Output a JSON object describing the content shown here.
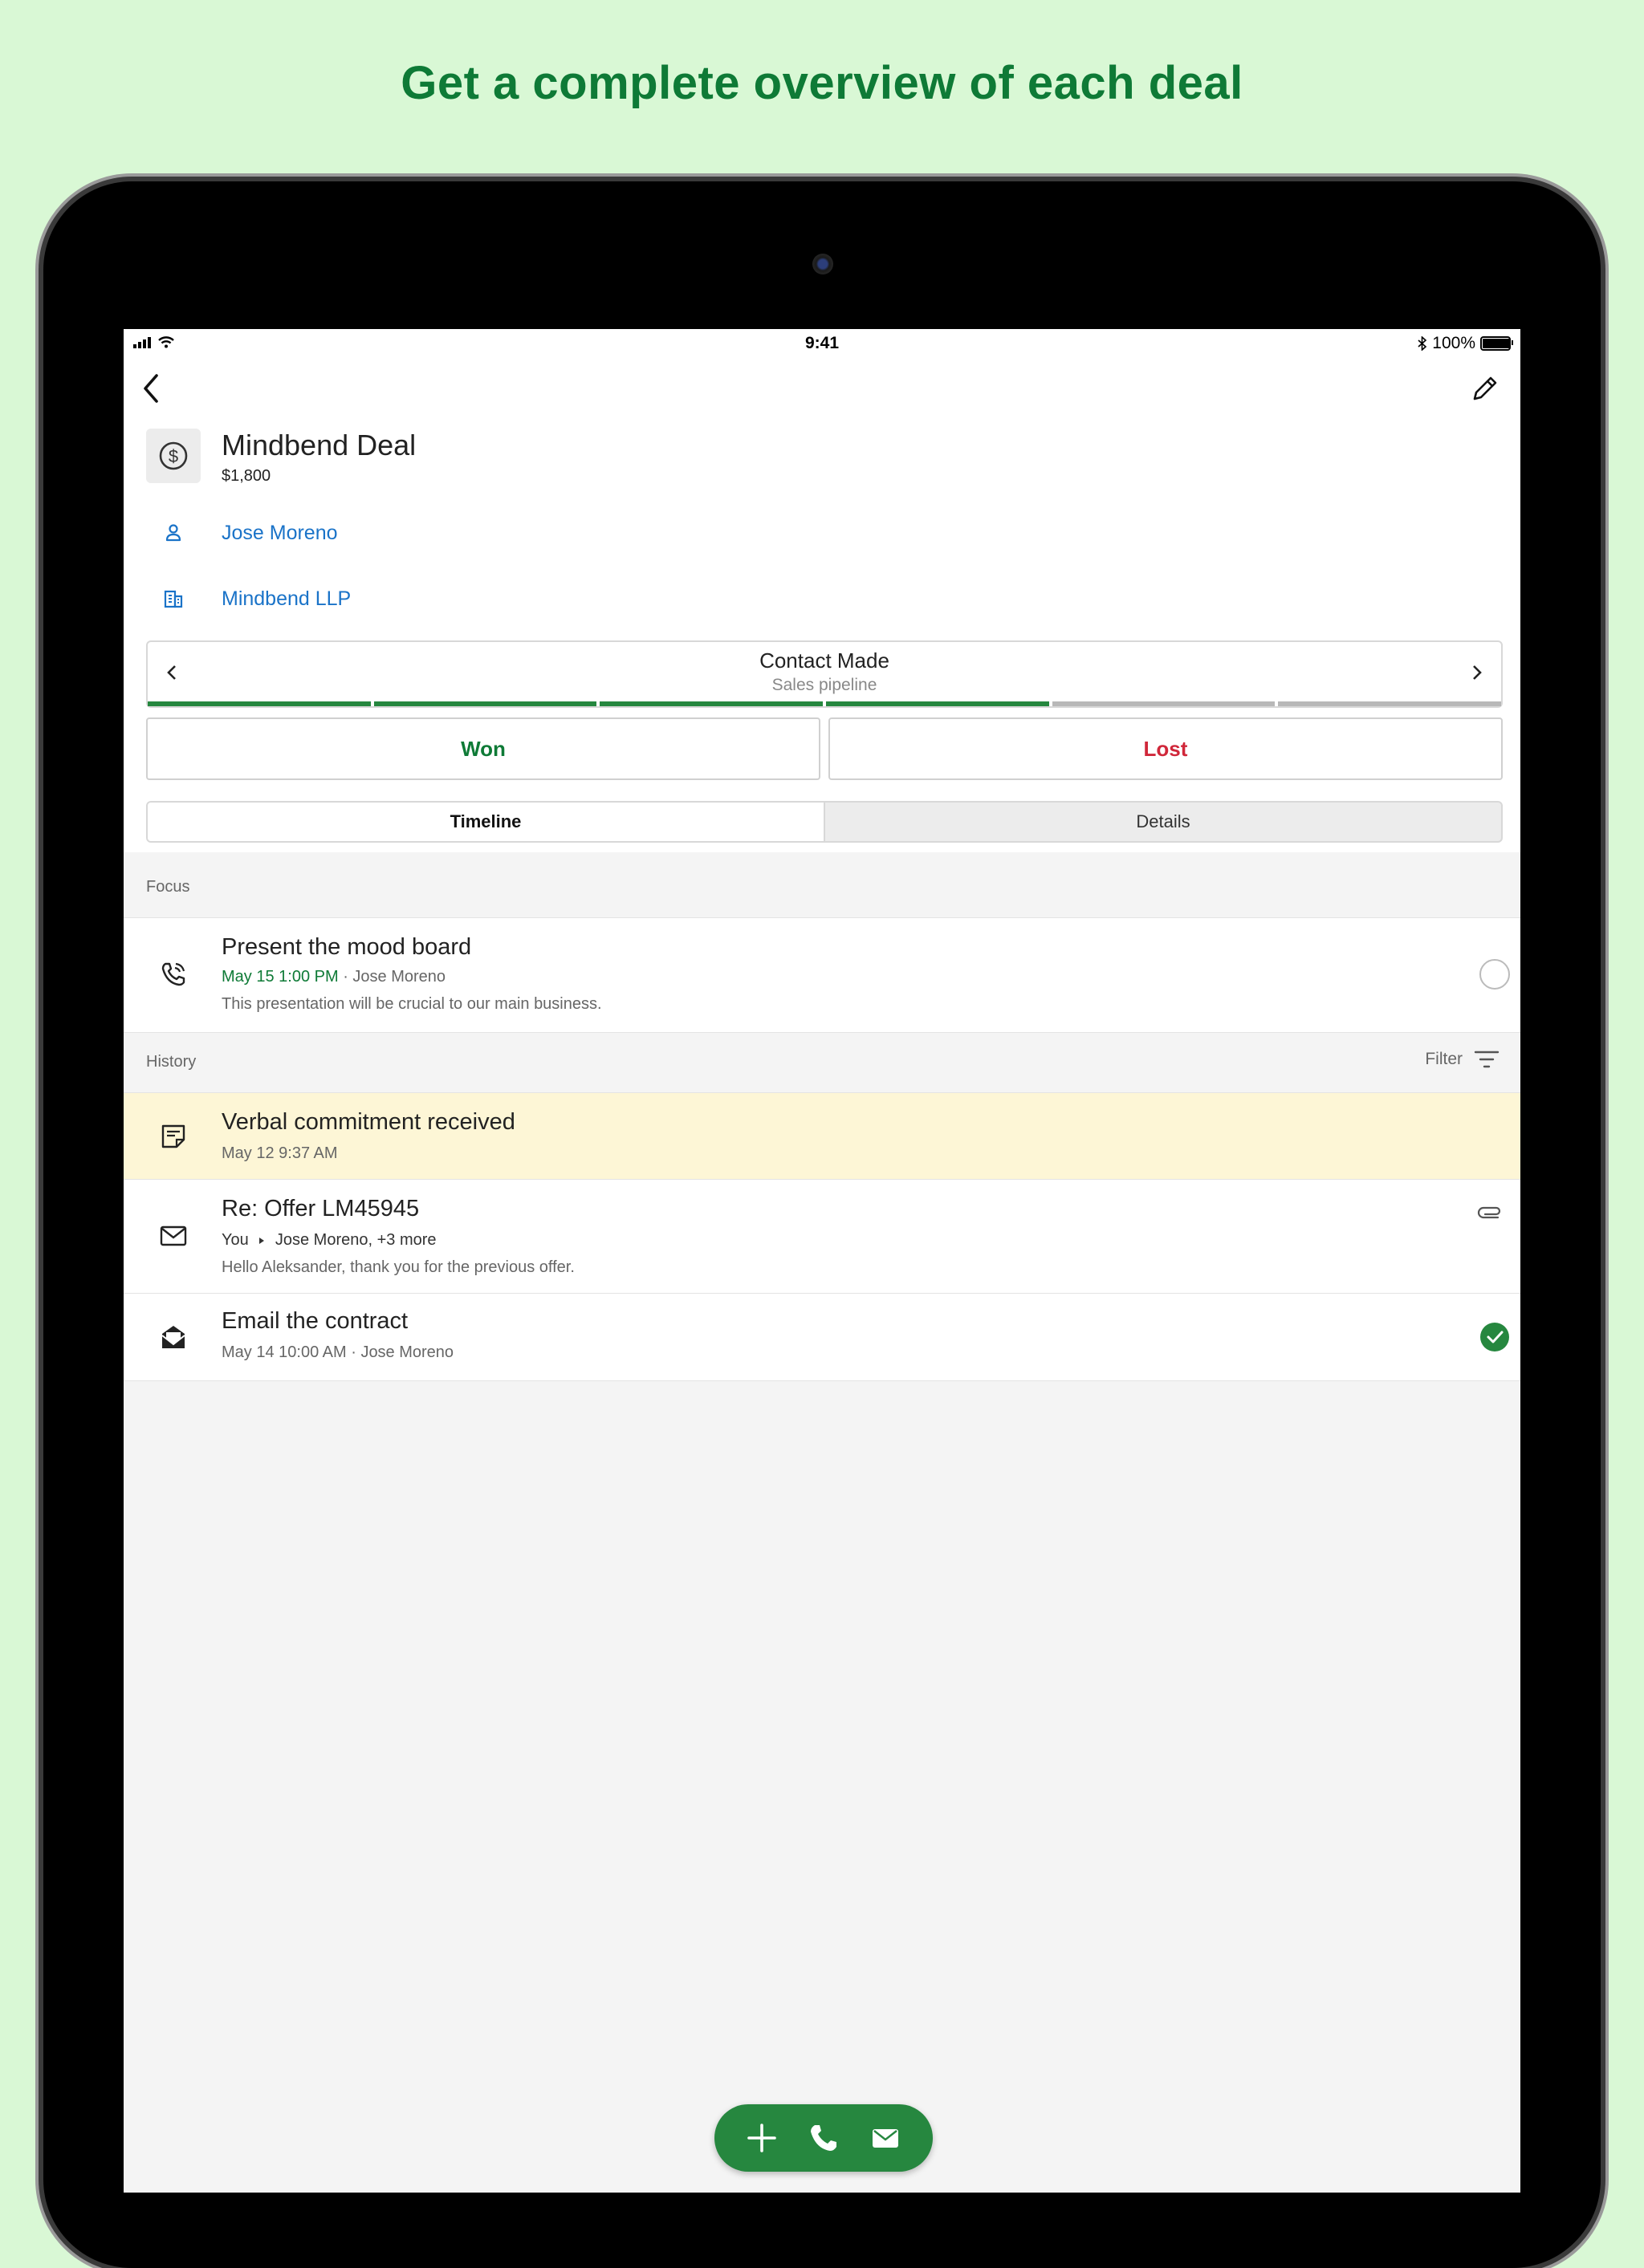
{
  "headline": "Get a complete overview of each deal",
  "status_bar": {
    "time": "9:41",
    "battery": "100%",
    "battery_level": 1.0
  },
  "deal": {
    "title": "Mindbend Deal",
    "value": "$1,800",
    "person": "Jose Moreno",
    "organization": "Mindbend LLP"
  },
  "stage": {
    "name": "Contact Made",
    "pipeline": "Sales pipeline",
    "steps_total": 6,
    "steps_completed": 4,
    "colors": {
      "done": "#26873f",
      "todo": "#b8b8b8"
    }
  },
  "actions": {
    "won": "Won",
    "lost": "Lost",
    "won_color": "#0e7a36",
    "lost_color": "#d0273a"
  },
  "tabs": {
    "timeline": "Timeline",
    "details": "Details",
    "active": "timeline"
  },
  "focus": {
    "label": "Focus",
    "items": [
      {
        "title": "Present the mood board",
        "date": "May 15 1:00 PM",
        "person": "Jose Moreno",
        "note": "This presentation will be crucial to our main business.",
        "icon": "phone-activity-icon",
        "done": false
      }
    ]
  },
  "history": {
    "label": "History",
    "filter": "Filter",
    "items": [
      {
        "title": "Verbal commitment received",
        "meta": "May 12 9:37 AM",
        "icon": "note-icon",
        "highlight": "#fdf6d6"
      },
      {
        "title": "Re: Offer LM45945",
        "from": "You",
        "to": "Jose Moreno, +3 more",
        "snippet": "Hello Aleksander, thank you for the previous offer.",
        "icon": "mail-icon",
        "attachment": true
      },
      {
        "title": "Email the contract",
        "date": "May 14 10:00 AM",
        "person": "Jose Moreno",
        "icon": "email-task-icon",
        "done": true
      }
    ]
  },
  "fab": [
    "add-icon",
    "call-icon",
    "mail-icon"
  ],
  "colors": {
    "accent": "#26873f",
    "link": "#1a73c8",
    "headline": "#0e7a36"
  }
}
